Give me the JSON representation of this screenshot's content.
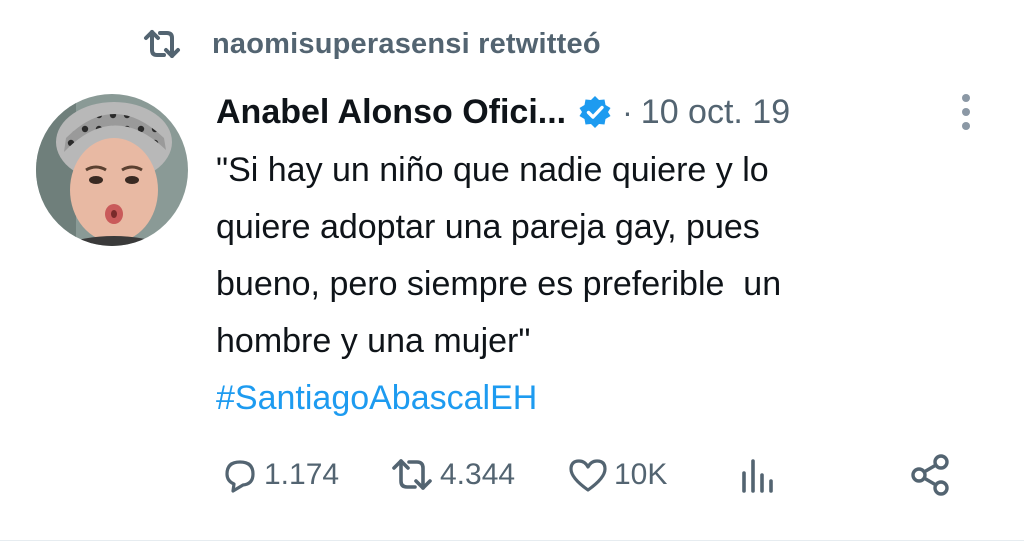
{
  "retweet": {
    "icon": "retweet-icon",
    "text": "naomisuperasensi retwitteó"
  },
  "tweet": {
    "author_name": "Anabel Alonso Ofici...",
    "verified_icon": "verified-badge-icon",
    "separator": "·",
    "date": "10 oct. 19",
    "body": "\"Si hay un niño que nadie quiere y lo\nquiere adoptar una pareja gay, pues\nbueno, pero siempre es preferible  un\nhombre y una mujer\"",
    "hashtag": "#SantiagoAbascalEH"
  },
  "actions": {
    "reply_count": "1.174",
    "retweet_count": "4.344",
    "like_count": "10K",
    "icons": [
      "reply-icon",
      "retweet-icon",
      "like-icon",
      "analytics-icon",
      "share-icon"
    ]
  },
  "colors": {
    "text": "#0f1419",
    "secondary": "#536471",
    "accent": "#1d9bf0"
  }
}
